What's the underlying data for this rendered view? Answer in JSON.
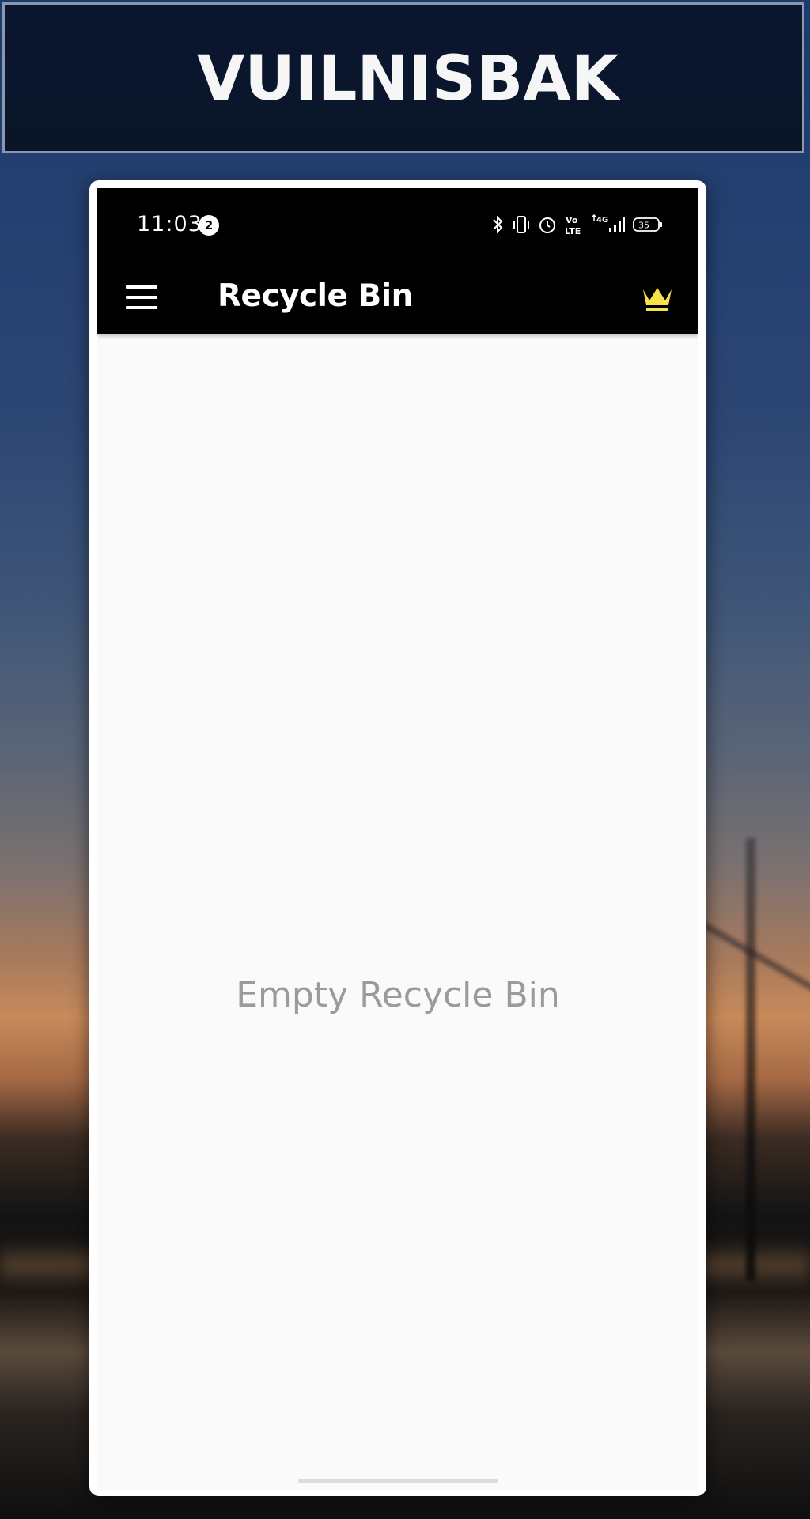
{
  "banner": {
    "title": "VUILNISBAK"
  },
  "status_bar": {
    "time": "11:03",
    "notification_count": "2",
    "battery": "35",
    "network": "4G",
    "volte": "Vo LTE",
    "icons": [
      "bluetooth-icon",
      "vibrate-icon",
      "alarm-icon",
      "volte-icon",
      "signal-4g-icon",
      "battery-icon"
    ]
  },
  "app_bar": {
    "title": "Recycle Bin",
    "menu_icon": "hamburger-menu-icon",
    "premium_icon": "crown-icon",
    "premium_color": "#f7e04a"
  },
  "content": {
    "empty_message": "Empty Recycle Bin"
  },
  "colors": {
    "app_bar": "#000000",
    "background": "#fafafa",
    "empty_text": "#9b9b9b"
  }
}
